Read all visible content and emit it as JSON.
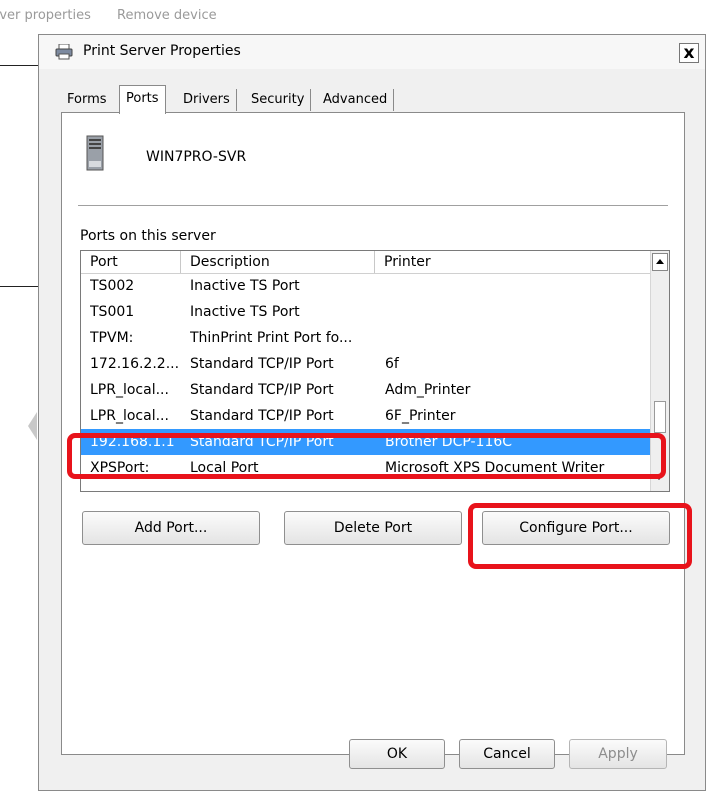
{
  "background": {
    "menu_items": [
      "rver properties",
      "Remove device"
    ]
  },
  "dialog": {
    "title": "Print Server Properties",
    "close_symbol": "x",
    "title_icon": "printer-icon",
    "tabs": [
      "Forms",
      "Ports",
      "Drivers",
      "Security",
      "Advanced"
    ],
    "active_tab": "Ports",
    "server_icon": "server-tower-icon",
    "server_name": "WIN7PRO-SVR",
    "ports_label": "Ports on this server",
    "table": {
      "columns": [
        "Port",
        "Description",
        "Printer"
      ],
      "rows": [
        {
          "port": "TS002",
          "description": "Inactive TS Port",
          "printer": ""
        },
        {
          "port": "TS001",
          "description": "Inactive TS Port",
          "printer": ""
        },
        {
          "port": "TPVM:",
          "description": "ThinPrint Print Port fo...",
          "printer": ""
        },
        {
          "port": "172.16.2.2...",
          "description": "Standard TCP/IP Port",
          "printer": "6f"
        },
        {
          "port": "LPR_local...",
          "description": "Standard TCP/IP Port",
          "printer": "Adm_Printer"
        },
        {
          "port": "LPR_local...",
          "description": "Standard TCP/IP Port",
          "printer": "6F_Printer"
        },
        {
          "port": "192.168.1.1",
          "description": "Standard TCP/IP Port",
          "printer": "Brother DCP-116C"
        },
        {
          "port": "XPSPort:",
          "description": "Local Port",
          "printer": "Microsoft XPS Document Writer"
        }
      ],
      "selected_row": 6
    },
    "buttons": {
      "add_port": "Add Port...",
      "delete_port": "Delete Port",
      "configure_port": "Configure Port...",
      "ok": "OK",
      "cancel": "Cancel",
      "apply": "Apply"
    },
    "colors": {
      "selection": "#3399ff",
      "highlight": "#e8131b"
    }
  }
}
